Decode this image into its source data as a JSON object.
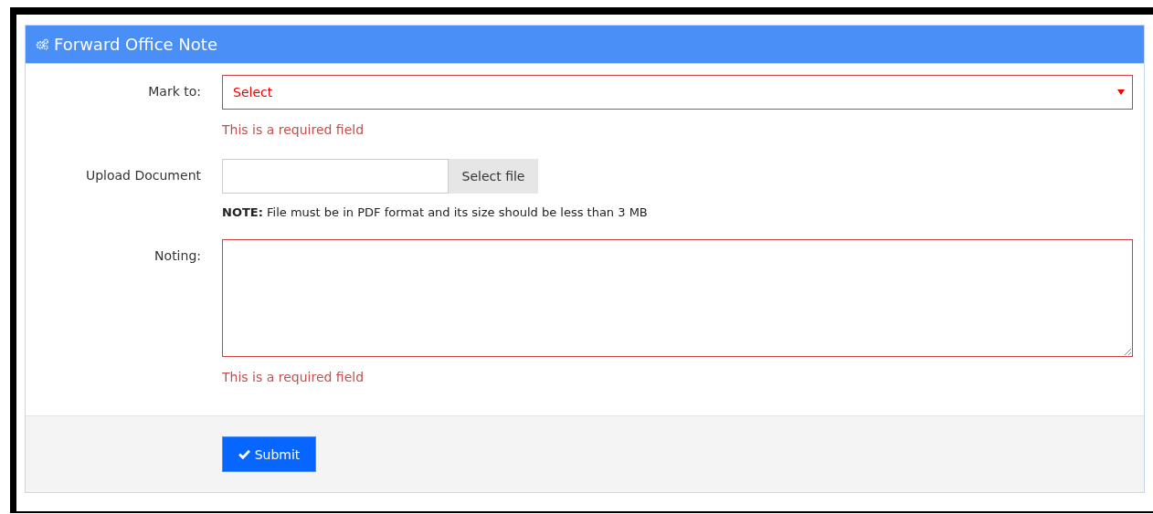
{
  "panel": {
    "title": "Forward Office Note"
  },
  "fields": [
    {
      "kind": "select",
      "label": "Mark to:",
      "value": "Select",
      "invalid": true,
      "error": "This is a required field"
    },
    {
      "kind": "file",
      "label": "Upload Document",
      "button": "Select file",
      "invalid": false,
      "note": "**NOTE:** File must be in PDF format and its size should be less than 3 MB"
    },
    {
      "kind": "textarea",
      "label": "Noting:",
      "invalid": true,
      "error": "This is a required field"
    }
  ],
  "submit": {
    "label": "Submit"
  }
}
